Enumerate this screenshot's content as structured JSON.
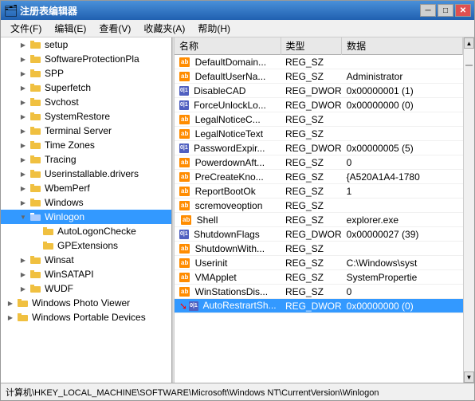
{
  "window": {
    "title": "注册表编辑器",
    "title_icon": "🗂",
    "btn_min": "─",
    "btn_max": "□",
    "btn_close": "✕"
  },
  "menu": {
    "items": [
      {
        "label": "文件(F)"
      },
      {
        "label": "编辑(E)"
      },
      {
        "label": "查看(V)"
      },
      {
        "label": "收藏夹(A)"
      },
      {
        "label": "帮助(H)"
      }
    ]
  },
  "tree": {
    "items": [
      {
        "id": "setup",
        "label": "setup",
        "indent": 1,
        "expanded": false,
        "selected": false
      },
      {
        "id": "SoftwareProtectionPla",
        "label": "SoftwareProtectionPla",
        "indent": 1,
        "expanded": false,
        "selected": false
      },
      {
        "id": "SPP",
        "label": "SPP",
        "indent": 1,
        "expanded": false,
        "selected": false
      },
      {
        "id": "Superfetch",
        "label": "Superfetch",
        "indent": 1,
        "expanded": false,
        "selected": false
      },
      {
        "id": "Svchost",
        "label": "Svchost",
        "indent": 1,
        "expanded": false,
        "selected": false
      },
      {
        "id": "SystemRestore",
        "label": "SystemRestore",
        "indent": 1,
        "expanded": false,
        "selected": false
      },
      {
        "id": "TerminalServer",
        "label": "Terminal Server",
        "indent": 1,
        "expanded": false,
        "selected": false
      },
      {
        "id": "TimeZones",
        "label": "Time Zones",
        "indent": 1,
        "expanded": false,
        "selected": false
      },
      {
        "id": "Tracing",
        "label": "Tracing",
        "indent": 1,
        "expanded": false,
        "selected": false
      },
      {
        "id": "Userinstallable",
        "label": "Userinstallable.drivers",
        "indent": 1,
        "expanded": false,
        "selected": false
      },
      {
        "id": "WbemPerf",
        "label": "WbemPerf",
        "indent": 1,
        "expanded": false,
        "selected": false
      },
      {
        "id": "Windows",
        "label": "Windows",
        "indent": 1,
        "expanded": false,
        "selected": false
      },
      {
        "id": "Winlogon",
        "label": "Winlogon",
        "indent": 1,
        "expanded": true,
        "selected": true
      },
      {
        "id": "AutoLogonChecke",
        "label": "AutoLogonChecke",
        "indent": 2,
        "expanded": false,
        "selected": false
      },
      {
        "id": "GPExtensions",
        "label": "GPExtensions",
        "indent": 2,
        "expanded": false,
        "selected": false
      },
      {
        "id": "Winsat",
        "label": "Winsat",
        "indent": 1,
        "expanded": false,
        "selected": false
      },
      {
        "id": "WinSATAPI",
        "label": "WinSATAPI",
        "indent": 1,
        "expanded": false,
        "selected": false
      },
      {
        "id": "WUDF",
        "label": "WUDF",
        "indent": 1,
        "expanded": false,
        "selected": false
      },
      {
        "id": "WindowsPhotoViewer",
        "label": "Windows Photo Viewer",
        "indent": 0,
        "expanded": false,
        "selected": false
      },
      {
        "id": "WindowsPortableDevices",
        "label": "Windows Portable Devices",
        "indent": 0,
        "expanded": false,
        "selected": false
      }
    ]
  },
  "table": {
    "headers": [
      "名称",
      "类型",
      "数据"
    ],
    "rows": [
      {
        "name": "DefaultDomain...",
        "type": "REG_SZ",
        "data": "",
        "icon": "ab"
      },
      {
        "name": "DefaultUserNa...",
        "type": "REG_SZ",
        "data": "Administrator",
        "icon": "ab"
      },
      {
        "name": "DisableCAD",
        "type": "REG_DWORD",
        "data": "0x00000001 (1)",
        "icon": "dword"
      },
      {
        "name": "ForceUnlockLo...",
        "type": "REG_DWORD",
        "data": "0x00000000 (0)",
        "icon": "dword"
      },
      {
        "name": "LegalNoticeC...",
        "type": "REG_SZ",
        "data": "",
        "icon": "ab"
      },
      {
        "name": "LegalNoticeText",
        "type": "REG_SZ",
        "data": "",
        "icon": "ab"
      },
      {
        "name": "PasswordExpir...",
        "type": "REG_DWORD",
        "data": "0x00000005 (5)",
        "icon": "dword"
      },
      {
        "name": "PowerdownAft...",
        "type": "REG_SZ",
        "data": "0",
        "icon": "ab"
      },
      {
        "name": "PreCreateKno...",
        "type": "REG_SZ",
        "data": "{A520A1A4-1780",
        "icon": "ab"
      },
      {
        "name": "ReportBootOk",
        "type": "REG_SZ",
        "data": "1",
        "icon": "ab"
      },
      {
        "name": "scremoveoption",
        "type": "REG_SZ",
        "data": "",
        "icon": "ab"
      },
      {
        "name": "Shell",
        "type": "REG_SZ",
        "data": "explorer.exe",
        "icon": "ab",
        "highlight": false
      },
      {
        "name": "ShutdownFlags",
        "type": "REG_DWORD",
        "data": "0x00000027 (39)",
        "icon": "dword"
      },
      {
        "name": "ShutdownWith...",
        "type": "REG_SZ",
        "data": "",
        "icon": "ab"
      },
      {
        "name": "Userinit",
        "type": "REG_SZ",
        "data": "C:\\Windows\\syst",
        "icon": "ab"
      },
      {
        "name": "VMApplet",
        "type": "REG_SZ",
        "data": "SystemPropertie",
        "icon": "ab"
      },
      {
        "name": "WinStationsDis...",
        "type": "REG_SZ",
        "data": "0",
        "icon": "ab"
      },
      {
        "name": "AutoRestrartSh...",
        "type": "REG_DWORD",
        "data": "0x00000000 (0)",
        "icon": "dword",
        "selected": true
      }
    ]
  },
  "status": {
    "path": "计算机\\HKEY_LOCAL_MACHINE\\SOFTWARE\\Microsoft\\Windows NT\\CurrentVersion\\Winlogon"
  }
}
